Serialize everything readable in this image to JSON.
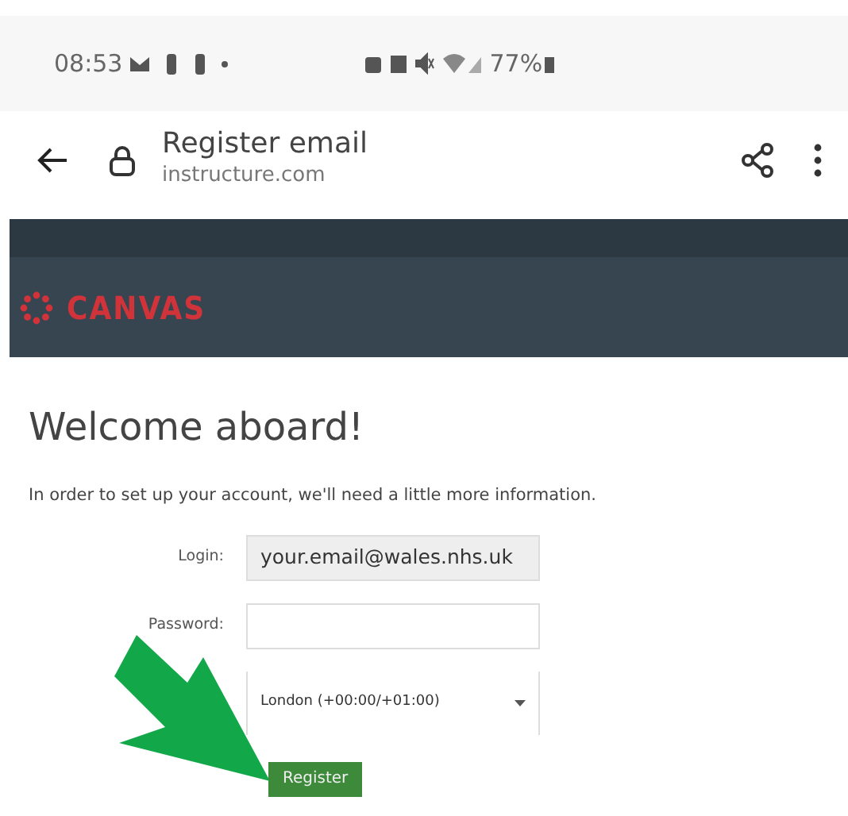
{
  "status_bar": {
    "time": "08:53",
    "battery": "77%"
  },
  "browser": {
    "title": "Register email",
    "url": "instructure.com"
  },
  "header": {
    "logo": "CANVAS"
  },
  "heading": "Welcome aboard!",
  "intro": "In order to set up your account, we'll need a little more information.",
  "fields": [
    {
      "kind": "text",
      "label": "Login:",
      "value": "your.email@wales.nhs.uk",
      "readonly": true
    },
    {
      "kind": "password",
      "label": "Password:",
      "readonly": false
    },
    {
      "kind": "select",
      "value": "London (+00:00/+01:00)",
      "readonly": false
    }
  ],
  "button": "Register"
}
